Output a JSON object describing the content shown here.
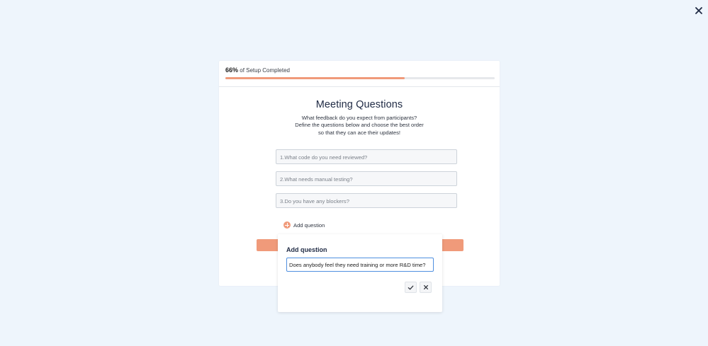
{
  "window": {
    "close_icon": "close-icon"
  },
  "progress": {
    "percent_text": "66%",
    "label": "of Setup Completed",
    "value": 0.667,
    "color": "#f09a7a"
  },
  "main": {
    "title": "Meeting Questions",
    "description_lines": [
      "What feedback do you expect from participants?",
      "Define the questions below and choose the best order",
      "so that they can ace their updates!"
    ],
    "questions": [
      "1.What code do you need reviewed?",
      "2.What needs manual testing?",
      "3.Do you have any blockers?"
    ],
    "add_question_label": "Add question",
    "add_question_icon": "plus-circle-icon"
  },
  "popup": {
    "title": "Add question",
    "input_value": "Does anybody feel they need training or more R&D time?",
    "confirm_icon": "check-icon",
    "cancel_icon": "close-icon"
  },
  "colors": {
    "background": "#eef5fc",
    "accent": "#f09a7a",
    "focus": "#4f8fe0"
  }
}
